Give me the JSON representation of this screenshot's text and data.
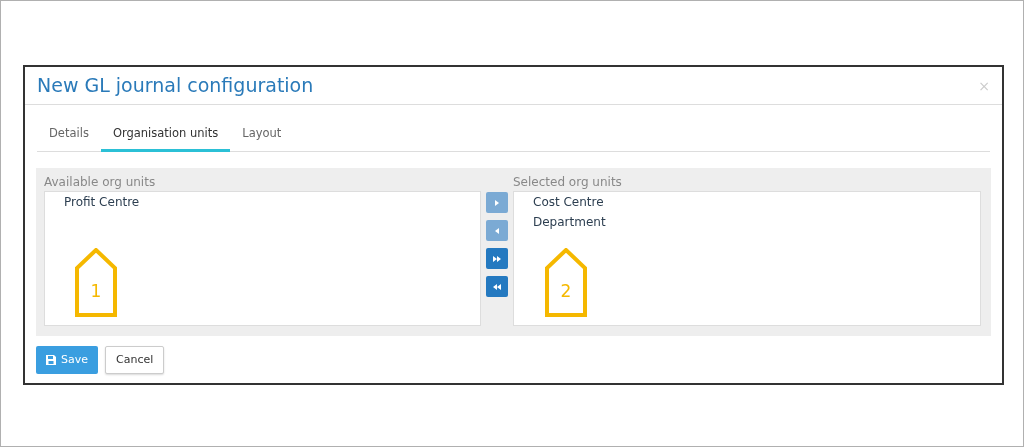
{
  "dialog": {
    "title": "New GL journal configuration",
    "close": "×"
  },
  "tabs": [
    {
      "label": "Details",
      "selected": false
    },
    {
      "label": "Organisation units",
      "selected": true
    },
    {
      "label": "Layout",
      "selected": false
    }
  ],
  "available": {
    "label": "Available org units",
    "items": [
      "Profit Centre"
    ],
    "callout": "1"
  },
  "transfer_buttons": [
    {
      "kind": "move-right",
      "disabled": true
    },
    {
      "kind": "move-left",
      "disabled": true
    },
    {
      "kind": "move-all-right",
      "disabled": false
    },
    {
      "kind": "move-all-left",
      "disabled": false
    }
  ],
  "selected": {
    "label": "Selected org units",
    "items": [
      "Cost Centre",
      "Department"
    ],
    "callout": "2"
  },
  "buttons": [
    {
      "label": "Save",
      "kind": "primary"
    },
    {
      "label": "Cancel",
      "kind": "default"
    }
  ]
}
